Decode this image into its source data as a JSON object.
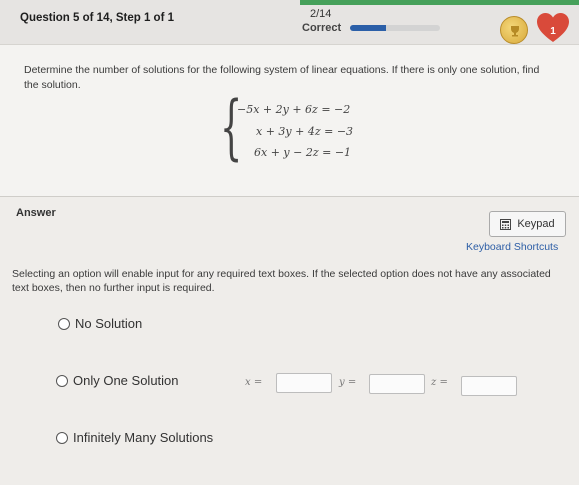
{
  "header": {
    "question_title": "Question 5 of 14, Step 1 of 1",
    "progress_fraction": "2/14",
    "progress_status": "Correct",
    "progress_percent": 40,
    "hearts_count": "1",
    "colors": {
      "accent": "#2b5fa8",
      "stripe": "#46a05a",
      "heart": "#d94a3a",
      "coin": "#d8a93b"
    }
  },
  "question": {
    "prompt": "Determine the number of solutions for the following system of linear equations. If there is only one solution, find the solution.",
    "equations": [
      "−5x + 2y + 6z = −2",
      "x + 3y + 4z = −3",
      "6x + y − 2z = −1"
    ]
  },
  "answer": {
    "label": "Answer",
    "keypad_label": "Keypad",
    "shortcuts_label": "Keyboard Shortcuts",
    "instructions": "Selecting an option will enable input for any required text boxes. If the selected option does not have any associated text boxes, then no further input is required.",
    "options": [
      "No Solution",
      "Only One Solution",
      "Infinitely Many Solutions"
    ],
    "variables": [
      "x =",
      "y =",
      "z ="
    ],
    "inputs": {
      "x": "",
      "y": "",
      "z": ""
    }
  },
  "icons": {
    "coin": "trophy-coin-icon",
    "heart": "heart-icon",
    "keypad": "keypad-icon",
    "radio": "radio-icon"
  }
}
